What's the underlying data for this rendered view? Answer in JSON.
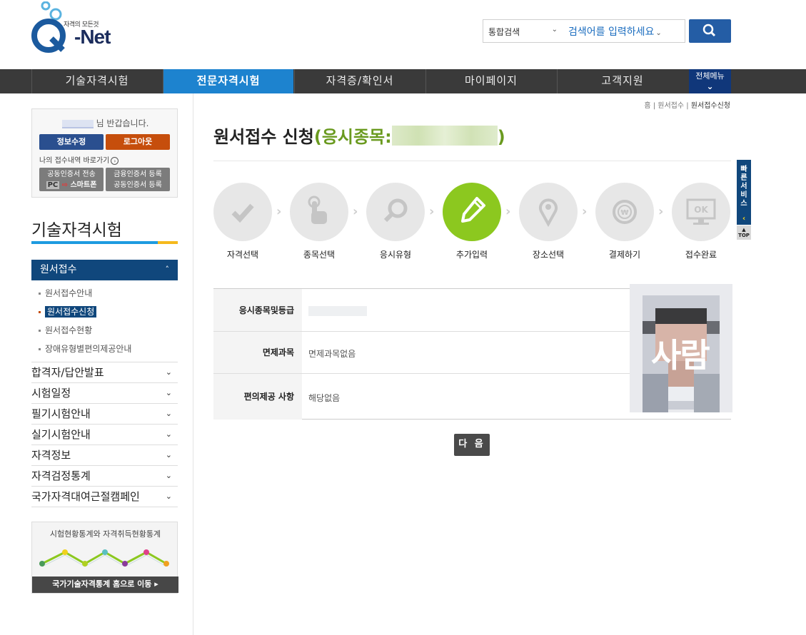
{
  "brand": {
    "tagline": "자격의 모든것",
    "name": "-Net"
  },
  "search": {
    "scope": "통합검색",
    "placeholder": "검색어를 입력하세요"
  },
  "gnb": {
    "items": [
      "기술자격시험",
      "전문자격시험",
      "자격증/확인서",
      "마이페이지",
      "고객지원"
    ],
    "active_index": 1,
    "all_menu": "전체메뉴"
  },
  "login": {
    "greeting": "님 반갑습니다.",
    "edit_label": "정보수정",
    "logout_label": "로그아웃",
    "my_link": "나의 접수내역 바로가기",
    "cert_send": {
      "line1": "공동인증서 전송",
      "pc": "PC",
      "arrow": "⇨",
      "phone": "스마트폰"
    },
    "cert_reg": {
      "line1": "금융인증서 등록",
      "line2": "공동인증서 등록"
    }
  },
  "sidebar": {
    "title": "기술자격시험",
    "main_menu": "원서접수",
    "sub_items": [
      "원서접수안내",
      "원서접수신청",
      "원서접수현황",
      "장애유형별편의제공안내"
    ],
    "active_sub": 1,
    "menus": [
      "합격자/답안발표",
      "시험일정",
      "필기시험안내",
      "실기시험안내",
      "자격정보",
      "자격검정통계",
      "국가자격대여근절캠페인"
    ],
    "stats_title": "시험현황통계와 자격취득현황통계",
    "stats_link": "국가기술자격통계 홈으로 이동"
  },
  "breadcrumb": {
    "home": "홈",
    "level1": "원서접수",
    "current": "원서접수신청"
  },
  "page": {
    "title": "원서접수 신청",
    "subtitle_prefix": "(응시종목:",
    "subtitle_suffix": ")"
  },
  "steps": [
    "자격선택",
    "종목선택",
    "응시유형",
    "추가입력",
    "장소선택",
    "결제하기",
    "접수완료"
  ],
  "active_step": 3,
  "form": {
    "rows": [
      {
        "label": "응시종목및등급",
        "value": ""
      },
      {
        "label": "면제과목",
        "value": "면제과목없음"
      },
      {
        "label": "편의제공 사항",
        "value": "해당없음"
      }
    ],
    "photo_text": "사람"
  },
  "next_button": "다 음",
  "quick_service": {
    "label": "빠른서비스",
    "top": "TOP"
  },
  "colors": {
    "primary_blue": "#1d83cf",
    "navy": "#10477c",
    "green": "#8cc81f",
    "orange": "#c64e0c"
  }
}
